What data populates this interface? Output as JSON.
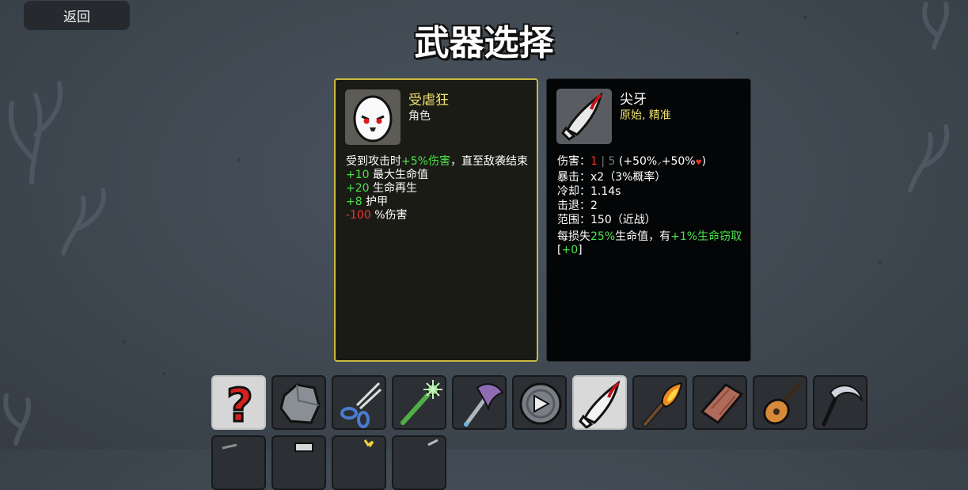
{
  "header": {
    "back_label": "返回",
    "title": "武器选择"
  },
  "character": {
    "name": "受虐狂",
    "type": "角色",
    "effect": {
      "prefix": "受到攻击时",
      "value": "+5%伤害",
      "suffix": "，直至敌袭结束"
    },
    "stats": [
      {
        "value": "+10",
        "label": "最大生命值"
      },
      {
        "value": "+20",
        "label": "生命再生"
      },
      {
        "value": "+8",
        "label": "护甲"
      },
      {
        "value": "-100",
        "label": "%伤害"
      }
    ]
  },
  "weapon": {
    "name": "尖牙",
    "classes": "原始, 精准",
    "damage": {
      "label": "伤害：",
      "v1": "1",
      "sep": " | ",
      "v2": "5",
      "scaling": " (+50%",
      "scaling2": "+50%",
      "close": ")"
    },
    "crit": "暴击：x2（3%概率）",
    "cooldown": "冷却：1.14s",
    "knockback": "击退：2",
    "range": "范围：150（近战）",
    "special": {
      "p1": "每损失",
      "v1": "25%",
      "p2": "生命值，有",
      "v2": "+1%生命窃取",
      "open": "[",
      "v3": "+0",
      "close": "]"
    }
  },
  "weapon_slots": [
    {
      "icon": "random-question-icon",
      "selected": false
    },
    {
      "icon": "rock-icon",
      "selected": false
    },
    {
      "icon": "scissors-icon",
      "selected": false
    },
    {
      "icon": "spiked-club-icon",
      "selected": false
    },
    {
      "icon": "double-axe-icon",
      "selected": false
    },
    {
      "icon": "spiked-shield-icon",
      "selected": false
    },
    {
      "icon": "fang-icon",
      "selected": true
    },
    {
      "icon": "torch-icon",
      "selected": false
    },
    {
      "icon": "brick-icon",
      "selected": false
    },
    {
      "icon": "lute-icon",
      "selected": false
    },
    {
      "icon": "sickle-icon",
      "selected": false
    }
  ],
  "colors": {
    "positive": "#4be34b",
    "negative": "#f0322d",
    "char_border": "#c9b93f",
    "char_name": "#f2e26c"
  }
}
